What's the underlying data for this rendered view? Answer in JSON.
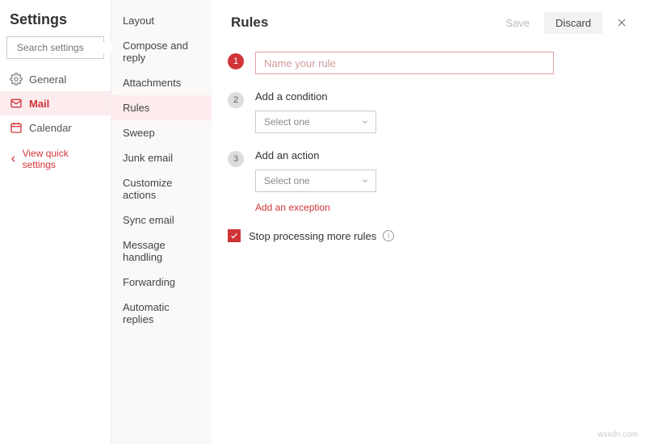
{
  "sidebar": {
    "title": "Settings",
    "search_placeholder": "Search settings",
    "nav": [
      {
        "label": "General",
        "icon": "gear"
      },
      {
        "label": "Mail",
        "icon": "mail",
        "active": true
      },
      {
        "label": "Calendar",
        "icon": "calendar"
      }
    ],
    "quick_link": "View quick settings"
  },
  "subnav": {
    "items": [
      "Layout",
      "Compose and reply",
      "Attachments",
      "Rules",
      "Sweep",
      "Junk email",
      "Customize actions",
      "Sync email",
      "Message handling",
      "Forwarding",
      "Automatic replies"
    ],
    "active_index": 3
  },
  "header": {
    "title": "Rules",
    "save": "Save",
    "discard": "Discard"
  },
  "steps": {
    "name_placeholder": "Name your rule",
    "condition_label": "Add a condition",
    "condition_select": "Select one",
    "action_label": "Add an action",
    "action_select": "Select one",
    "exception_link": "Add an exception"
  },
  "stop_processing": {
    "label": "Stop processing more rules",
    "checked": true
  },
  "watermark": "wsxdn.com"
}
